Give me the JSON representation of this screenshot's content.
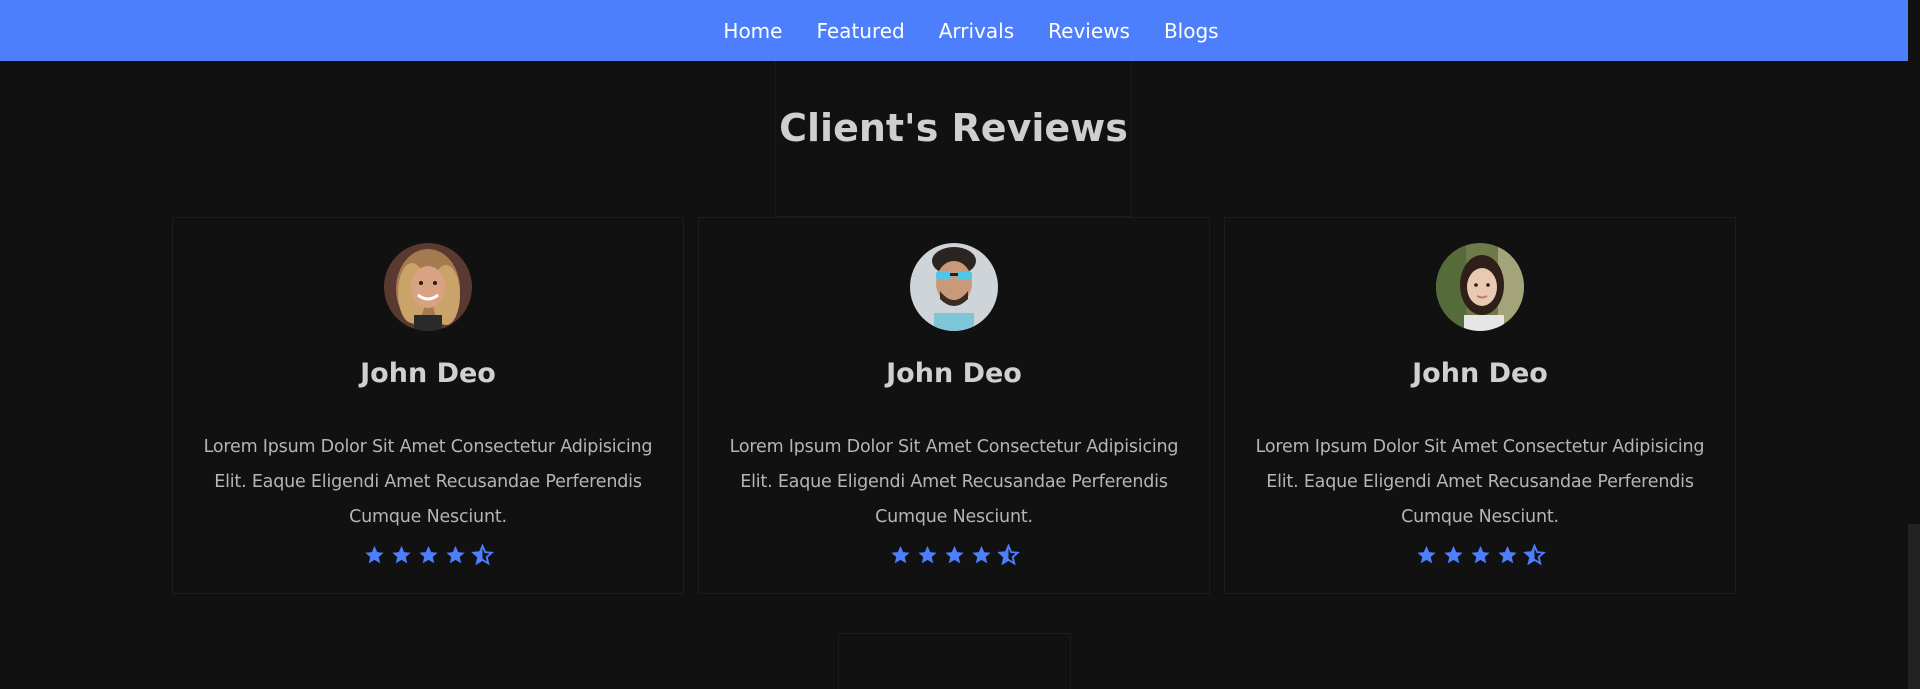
{
  "nav": {
    "items": [
      {
        "label": "Home"
      },
      {
        "label": "Featured"
      },
      {
        "label": "Arrivals"
      },
      {
        "label": "Reviews"
      },
      {
        "label": "Blogs"
      }
    ]
  },
  "reviews_section": {
    "title": "Client's Reviews",
    "cards": [
      {
        "name": "John Deo",
        "text": "Lorem Ipsum Dolor Sit Amet Consectetur Adipisicing Elit. Eaque Eligendi Amet Recusandae Perferendis Cumque Nesciunt.",
        "rating": 4.5,
        "avatar_icon": "woman-avatar"
      },
      {
        "name": "John Deo",
        "text": "Lorem Ipsum Dolor Sit Amet Consectetur Adipisicing Elit. Eaque Eligendi Amet Recusandae Perferendis Cumque Nesciunt.",
        "rating": 4.5,
        "avatar_icon": "man-sunglasses-avatar"
      },
      {
        "name": "John Deo",
        "text": "Lorem Ipsum Dolor Sit Amet Consectetur Adipisicing Elit. Eaque Eligendi Amet Recusandae Perferendis Cumque Nesciunt.",
        "rating": 4.5,
        "avatar_icon": "woman-avatar"
      }
    ]
  },
  "colors": {
    "accent": "#4d7ffc",
    "background": "#111111",
    "heading": "#cfcfcf",
    "body_text": "#b5b5b5"
  }
}
